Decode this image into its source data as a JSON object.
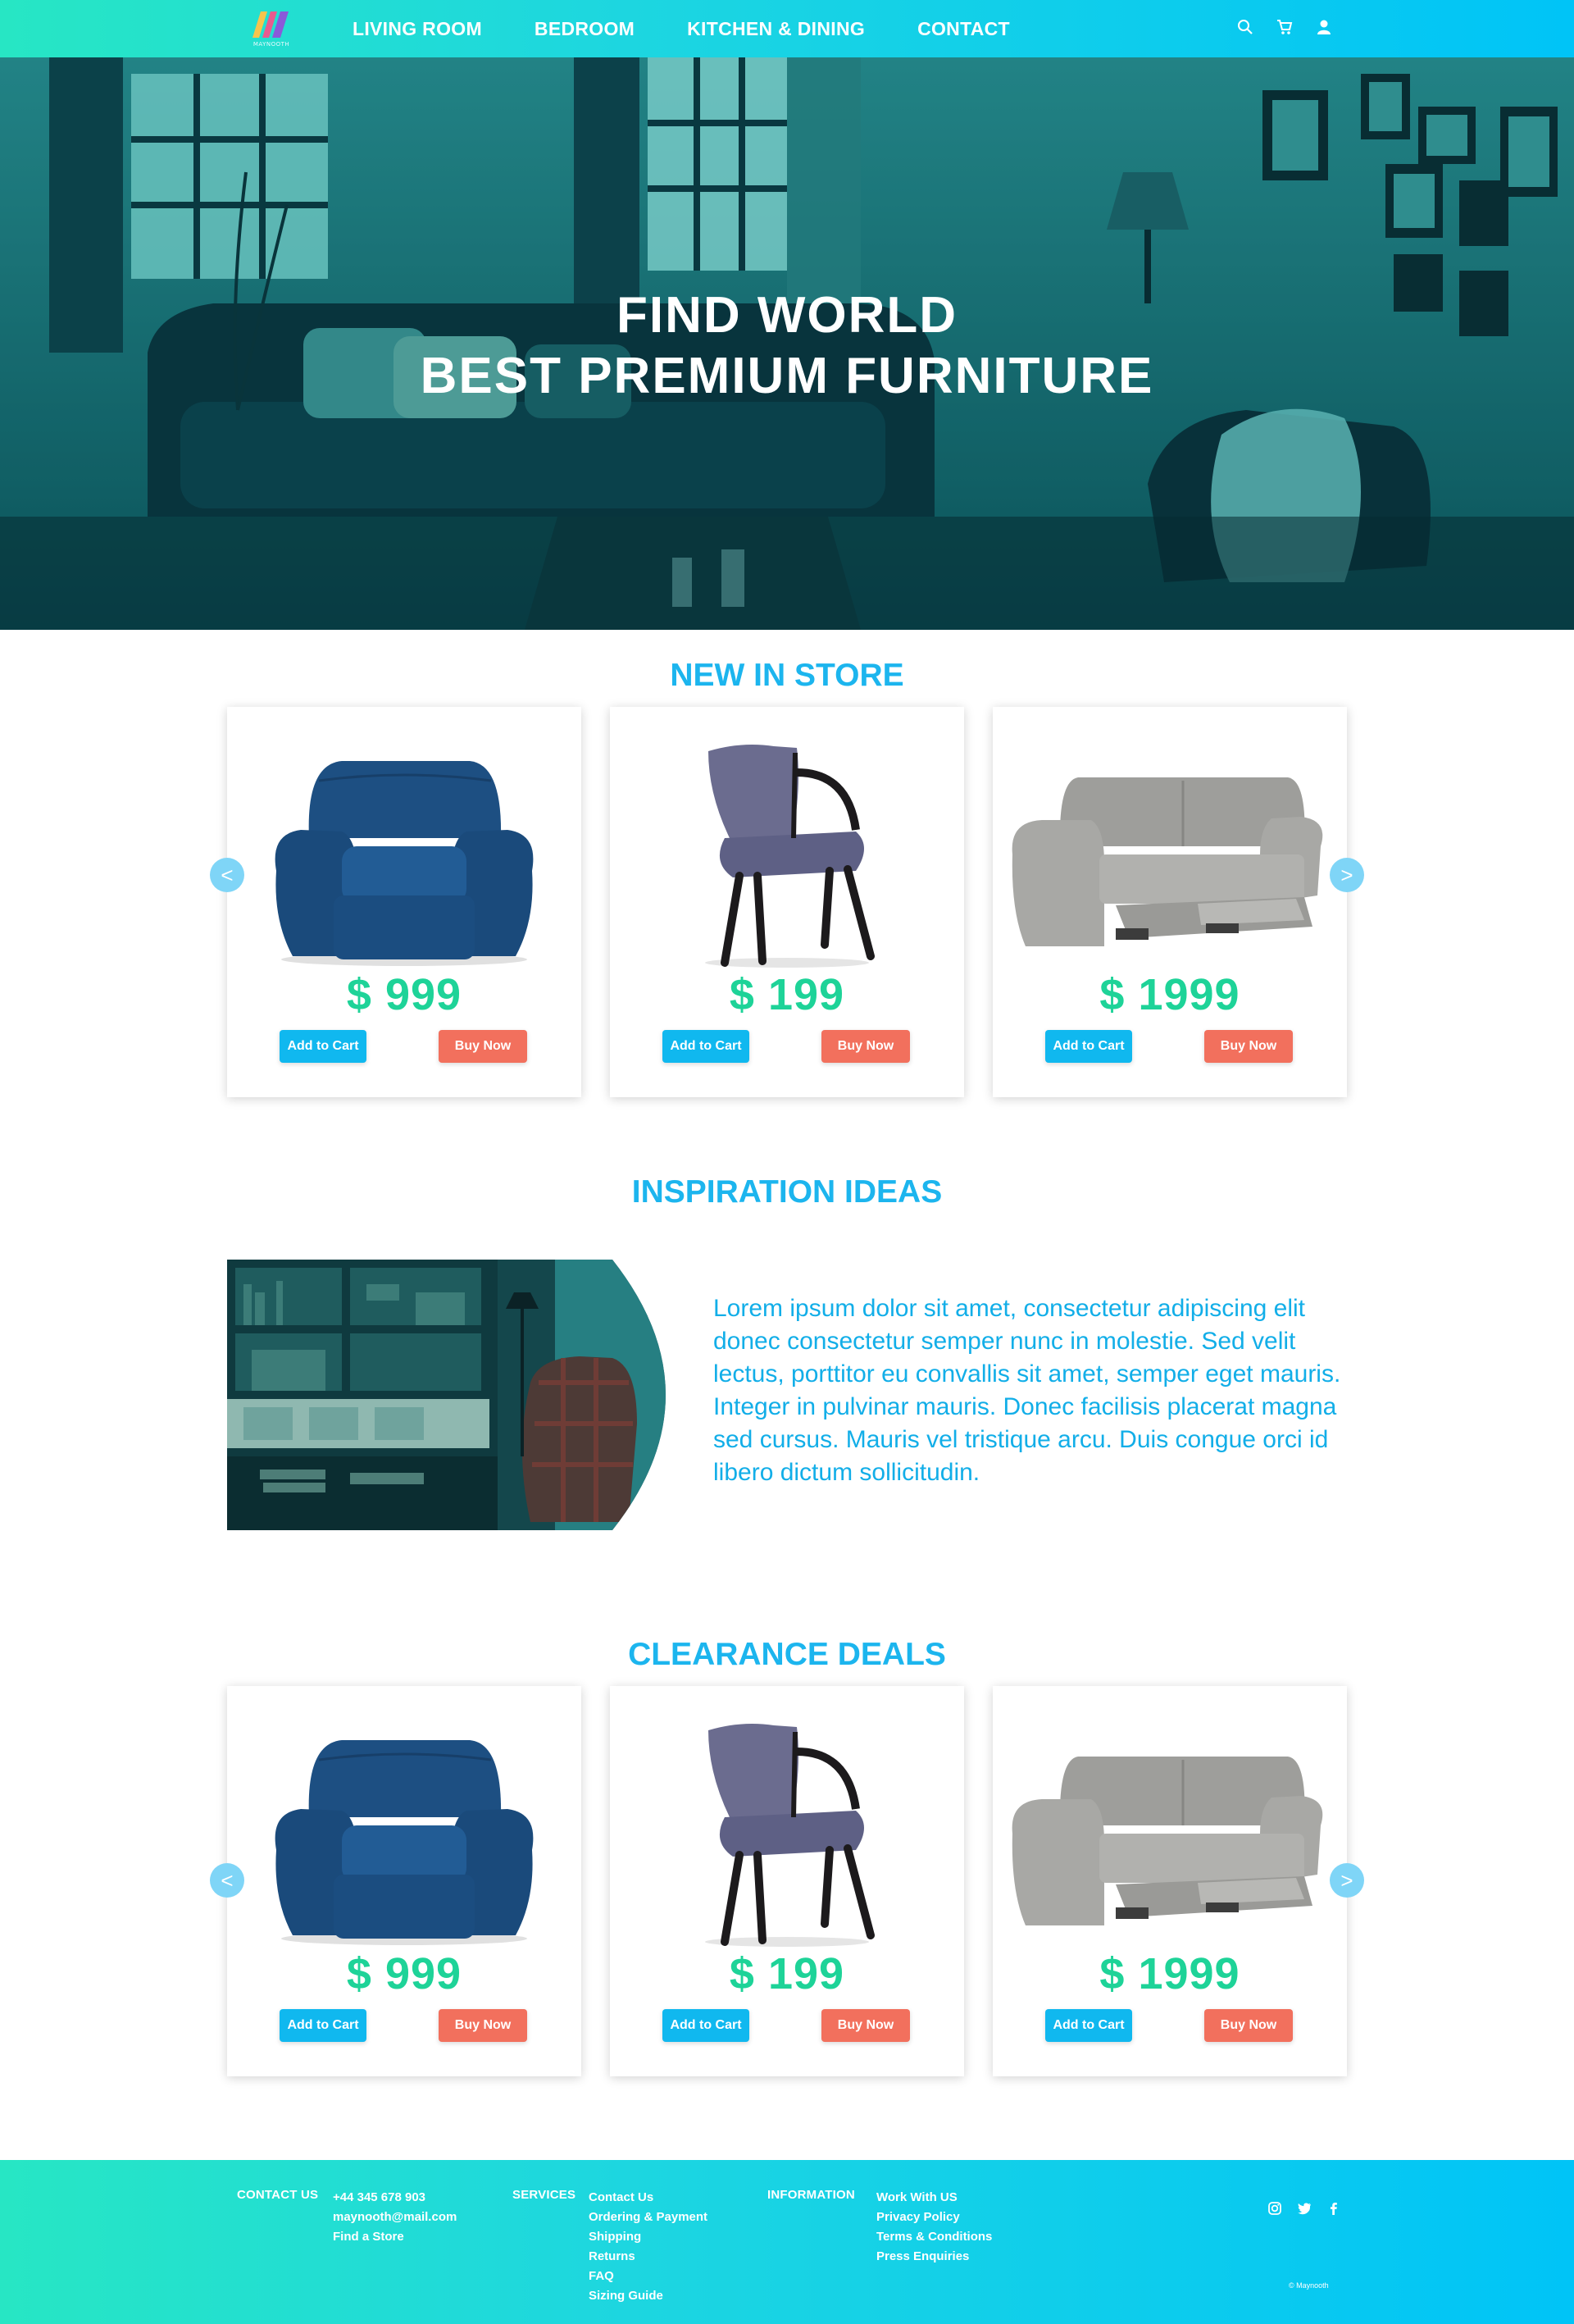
{
  "header": {
    "logo_text": "MAYNOOTH",
    "nav": [
      "LIVING ROOM",
      "BEDROOM",
      "KITCHEN & DINING",
      "CONTACT"
    ],
    "icons": [
      "search-icon",
      "cart-icon",
      "user-icon"
    ]
  },
  "hero": {
    "title_line1": "FIND WORLD",
    "title_line2": "BEST PREMIUM FURNITURE"
  },
  "new_in_store": {
    "title": "NEW IN STORE",
    "prev": "<",
    "next": ">",
    "products": [
      {
        "type": "armchair",
        "price": "$ 999",
        "add_label": "Add to Cart",
        "buy_label": "Buy Now"
      },
      {
        "type": "dining-chair",
        "price": "$ 199",
        "add_label": "Add to Cart",
        "buy_label": "Buy Now"
      },
      {
        "type": "recliner-sofa",
        "price": "$ 1999",
        "add_label": "Add to Cart",
        "buy_label": "Buy Now"
      }
    ]
  },
  "inspiration": {
    "title": "INSPIRATION IDEAS",
    "text": "Lorem ipsum dolor sit amet, consectetur adipiscing elit donec consectetur semper nunc in molestie. Sed velit lectus, porttitor eu convallis sit amet, semper eget mauris. Integer in pulvinar mauris. Donec facilisis placerat magna sed cursus. Mauris vel tristique arcu. Duis congue orci id libero dictum sollicitudin."
  },
  "clearance": {
    "title": "CLEARANCE DEALS",
    "prev": "<",
    "next": ">",
    "products": [
      {
        "type": "armchair",
        "price": "$ 999",
        "add_label": "Add to Cart",
        "buy_label": "Buy Now"
      },
      {
        "type": "dining-chair",
        "price": "$ 199",
        "add_label": "Add to Cart",
        "buy_label": "Buy Now"
      },
      {
        "type": "recliner-sofa",
        "price": "$ 1999",
        "add_label": "Add to Cart",
        "buy_label": "Buy Now"
      }
    ]
  },
  "footer": {
    "contact_title": "CONTACT US",
    "contact_items": [
      "+44 345 678 903",
      "maynooth@mail.com",
      "Find a Store"
    ],
    "services_title": "SERVICES",
    "services_items": [
      "Contact Us",
      "Ordering & Payment",
      "Shipping",
      "Returns",
      "FAQ",
      "Sizing Guide"
    ],
    "information_title": "INFORMATION",
    "information_items": [
      "Work With US",
      "Privacy Policy",
      "Terms & Conditions",
      "Press Enquiries"
    ],
    "social": [
      "instagram-icon",
      "twitter-icon",
      "facebook-icon"
    ],
    "copyright": "© Maynooth"
  },
  "colors": {
    "accent": "#1cb5ee",
    "price": "#1ed398",
    "cart_button": "#10b8ef",
    "buy_button": "#f2705d",
    "gradient_start": "#27e6c4",
    "gradient_end": "#00c4f7"
  }
}
